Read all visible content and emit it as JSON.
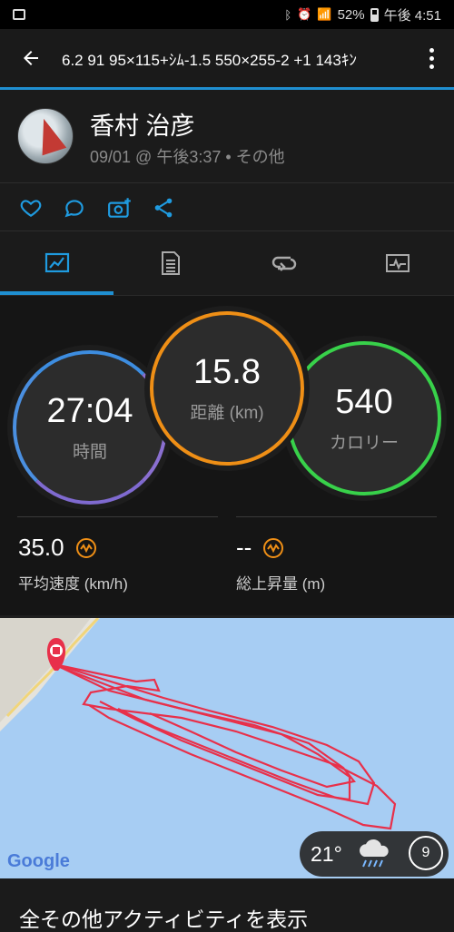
{
  "status_bar": {
    "battery": "52%",
    "time": "午後 4:51"
  },
  "app_bar": {
    "title": "6.2 91 95×115+ｼﾑ-1.5 550×255-2 +1 143ｷﾝ"
  },
  "profile": {
    "name": "香村 治彦",
    "subline": "09/01 @ 午後3:37 • その他"
  },
  "actions": [
    "heart-icon",
    "comment-icon",
    "camera-add-icon",
    "share-icon"
  ],
  "tabs": [
    "summary",
    "laps",
    "splits",
    "charts"
  ],
  "stats": {
    "time_value": "27:04",
    "time_label": "時間",
    "distance_value": "15.8",
    "distance_label": "距離 (km)",
    "calories_value": "540",
    "calories_label": "カロリー",
    "avg_speed_value": "35.0",
    "avg_speed_label": "平均速度 (km/h)",
    "ascent_value": "--",
    "ascent_label": "総上昇量 (m)"
  },
  "colors": {
    "accent": "#1f8fd1",
    "time_ring": "#6f6fd8",
    "distance_ring": "#ef8f16",
    "calories_ring": "#38d14a",
    "track": "#e8304a"
  },
  "map": {
    "provider": "Google",
    "temperature": "21°",
    "wind": "9"
  },
  "footer": {
    "link_text": "全その他アクティビティを表示"
  }
}
